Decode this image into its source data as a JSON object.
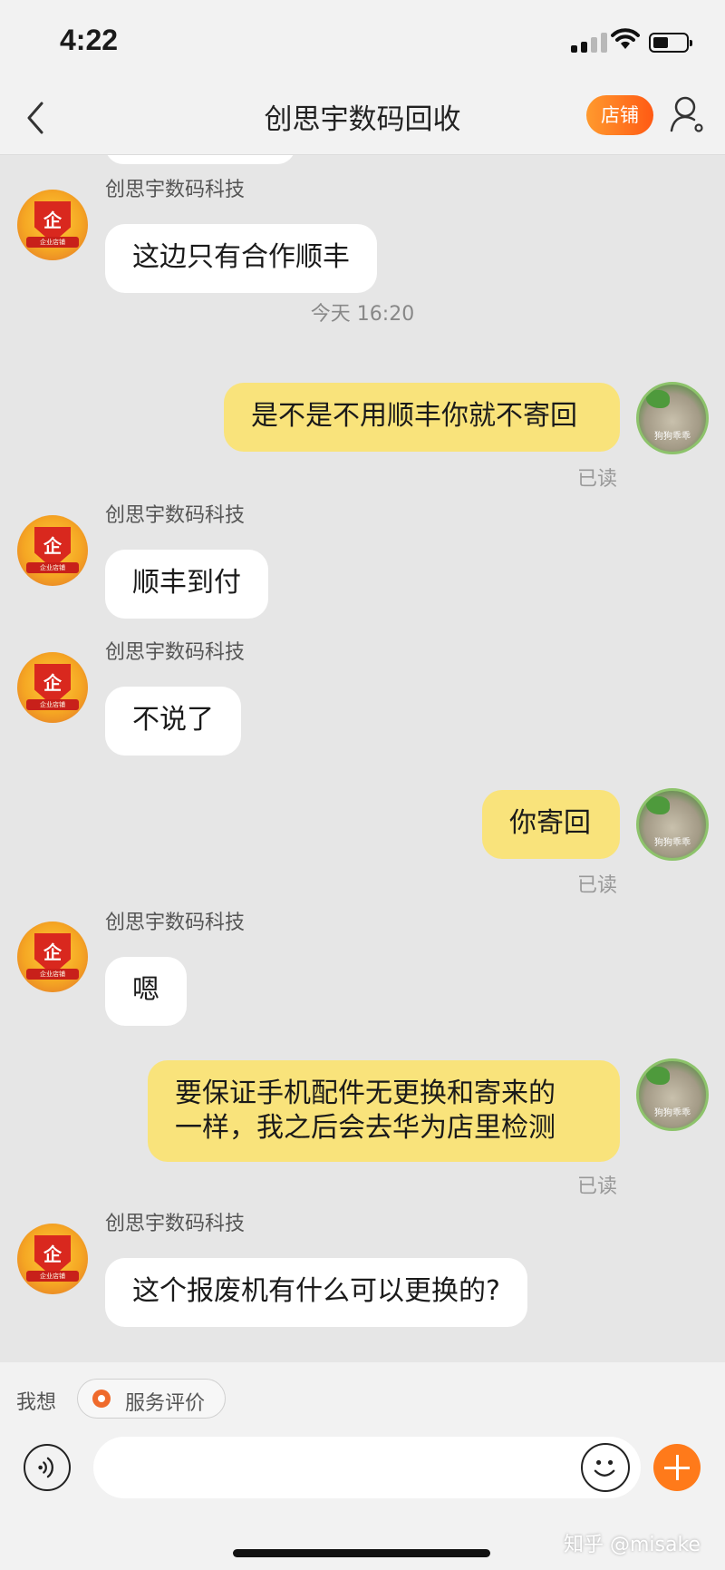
{
  "status_bar": {
    "time": "4:22"
  },
  "header": {
    "title": "创思宇数码回收",
    "shop_label": "店铺"
  },
  "messages": [
    {
      "sender": "创思宇数码科技",
      "text": "这边只有合作顺丰"
    },
    {
      "timestamp": "今天 16:20"
    },
    {
      "text": "是不是不用顺丰你就不寄回",
      "read": "已读"
    },
    {
      "sender": "创思宇数码科技",
      "text": "顺丰到付"
    },
    {
      "sender": "创思宇数码科技",
      "text": "不说了"
    },
    {
      "text": "你寄回",
      "read": "已读"
    },
    {
      "sender": "创思宇数码科技",
      "text": "嗯"
    },
    {
      "lines": [
        "要保证手机配件无更换和寄来的",
        "一样，我之后会去华为店里检测"
      ],
      "read": "已读"
    },
    {
      "sender": "创思宇数码科技",
      "text": "这个报废机有什么可以更换的?"
    }
  ],
  "quick_bar": {
    "label": "我想",
    "chip": "服务评价"
  },
  "avatars": {
    "merchant_badge": "企",
    "merchant_ribbon": "企业店铺",
    "user_label": "狗狗乖乖"
  },
  "watermark": "知乎 @misake"
}
